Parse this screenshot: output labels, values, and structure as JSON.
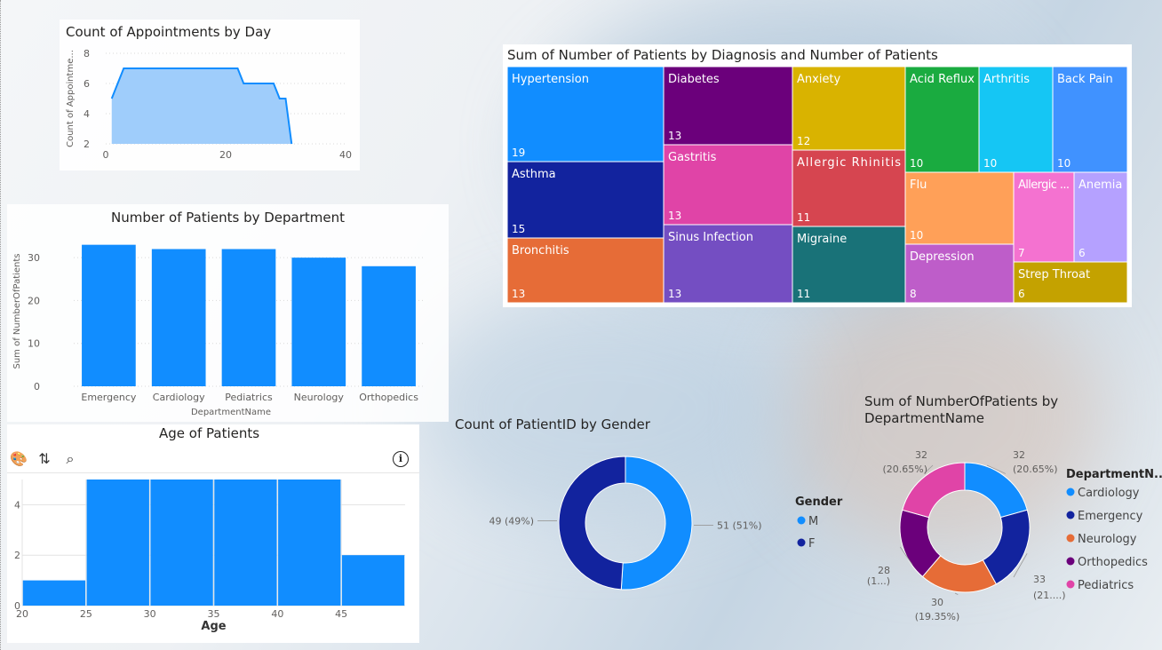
{
  "colors": {
    "primary": "#118DFF",
    "navy": "#12239E",
    "orange": "#E66C37",
    "purple": "#6B007B",
    "pink": "#E044A7",
    "area_fill": "#9FCDFB"
  },
  "appointments_chart": {
    "title": "Count of Appointments by Day"
  },
  "department_bar_chart": {
    "title": "Number of Patients by Department"
  },
  "age_chart": {
    "title": "Age of Patients",
    "toolbar_icons": [
      "palette-icon",
      "sort-icon",
      "zoom-icon"
    ],
    "info_icon": "info-icon"
  },
  "treemap_chart": {
    "title": "Sum of Number of Patients by Diagnosis and Number of Patients"
  },
  "gender_chart": {
    "title": "Count of PatientID by Gender",
    "legend_title": "Gender"
  },
  "department_donut_chart": {
    "title_line1": "Sum of NumberOfPatients by",
    "title_line2": "DepartmentName",
    "legend_title": "DepartmentN..."
  },
  "chart_data": [
    {
      "type": "area",
      "title": "Count of Appointments by Day",
      "xlabel": "",
      "ylabel": "Count of Appointme...",
      "xlim": [
        0,
        40
      ],
      "ylim": [
        2,
        8
      ],
      "xticks": [
        0,
        20,
        40
      ],
      "yticks": [
        2,
        4,
        6,
        8
      ],
      "x": [
        1,
        3,
        22,
        23,
        28,
        29,
        30,
        31
      ],
      "y": [
        5,
        7,
        7,
        6,
        6,
        5,
        5,
        2
      ]
    },
    {
      "type": "bar",
      "title": "Number of Patients by Department",
      "xlabel": "DepartmentName",
      "ylabel": "Sum of NumberOfPatients",
      "ylim": [
        0,
        35
      ],
      "yticks": [
        0,
        10,
        20,
        30
      ],
      "categories": [
        "Emergency",
        "Cardiology",
        "Pediatrics",
        "Neurology",
        "Orthopedics"
      ],
      "values": [
        33,
        32,
        32,
        30,
        28
      ]
    },
    {
      "type": "bar",
      "title": "Age of Patients",
      "xlabel": "Age",
      "ylabel": "",
      "xlim": [
        20,
        50
      ],
      "ylim": [
        0,
        5
      ],
      "xticks": [
        20,
        25,
        30,
        35,
        40,
        45
      ],
      "yticks": [
        0,
        2,
        4
      ],
      "bins": [
        {
          "from": 20,
          "to": 25,
          "count": 1
        },
        {
          "from": 25,
          "to": 30,
          "count": 5
        },
        {
          "from": 30,
          "to": 35,
          "count": 5
        },
        {
          "from": 35,
          "to": 40,
          "count": 5
        },
        {
          "from": 40,
          "to": 45,
          "count": 5
        },
        {
          "from": 45,
          "to": 50,
          "count": 2
        }
      ]
    },
    {
      "type": "treemap",
      "title": "Sum of Number of Patients by Diagnosis and Number of Patients",
      "items": [
        {
          "label": "Hypertension",
          "value": 19,
          "color": "#118DFF"
        },
        {
          "label": "Asthma",
          "value": 15,
          "color": "#12239E"
        },
        {
          "label": "Bronchitis",
          "value": 13,
          "color": "#E66C37"
        },
        {
          "label": "Diabetes",
          "value": 13,
          "color": "#6B007B"
        },
        {
          "label": "Gastritis",
          "value": 13,
          "color": "#E044A7"
        },
        {
          "label": "Sinus Infection",
          "value": 13,
          "color": "#744EC2"
        },
        {
          "label": "Anxiety",
          "value": 12,
          "color": "#D9B300"
        },
        {
          "label": "Allergic Rhinitis",
          "value": 11,
          "color": "#D64550"
        },
        {
          "label": "Migraine",
          "value": 11,
          "color": "#197278"
        },
        {
          "label": "Acid Reflux",
          "value": 10,
          "color": "#1AAB40"
        },
        {
          "label": "Arthritis",
          "value": 10,
          "color": "#15C6F4"
        },
        {
          "label": "Back Pain",
          "value": 10,
          "color": "#4092FF"
        },
        {
          "label": "Flu",
          "value": 10,
          "color": "#FFA058"
        },
        {
          "label": "Depression",
          "value": 8,
          "color": "#BE5DC9"
        },
        {
          "label": "Allergic ...",
          "value": 7,
          "color": "#F472D0"
        },
        {
          "label": "Anemia",
          "value": 6,
          "color": "#B5A1FF"
        },
        {
          "label": "Strep Throat",
          "value": 6,
          "color": "#C4A200"
        }
      ]
    },
    {
      "type": "pie",
      "title": "Count of PatientID by Gender",
      "legend_title": "Gender",
      "slices": [
        {
          "label": "M",
          "value": 51,
          "display": "51 (51%)",
          "color": "#118DFF"
        },
        {
          "label": "F",
          "value": 49,
          "display": "49 (49%)",
          "color": "#12239E"
        }
      ]
    },
    {
      "type": "pie",
      "title": "Sum of NumberOfPatients by DepartmentName",
      "legend_title": "DepartmentN...",
      "slices": [
        {
          "label": "Cardiology",
          "value": 32,
          "line1": "32",
          "line2": "(20.65%)",
          "color": "#118DFF"
        },
        {
          "label": "Emergency",
          "value": 33,
          "line1": "33",
          "line2": "(21....)",
          "color": "#12239E"
        },
        {
          "label": "Neurology",
          "value": 30,
          "line1": "30",
          "line2": "(19.35%)",
          "color": "#E66C37"
        },
        {
          "label": "Orthopedics",
          "value": 28,
          "line1": "28",
          "line2": "(1...)",
          "color": "#6B007B"
        },
        {
          "label": "Pediatrics",
          "value": 32,
          "line1": "32",
          "line2": "(20.65%)",
          "color": "#E044A7"
        }
      ]
    }
  ]
}
